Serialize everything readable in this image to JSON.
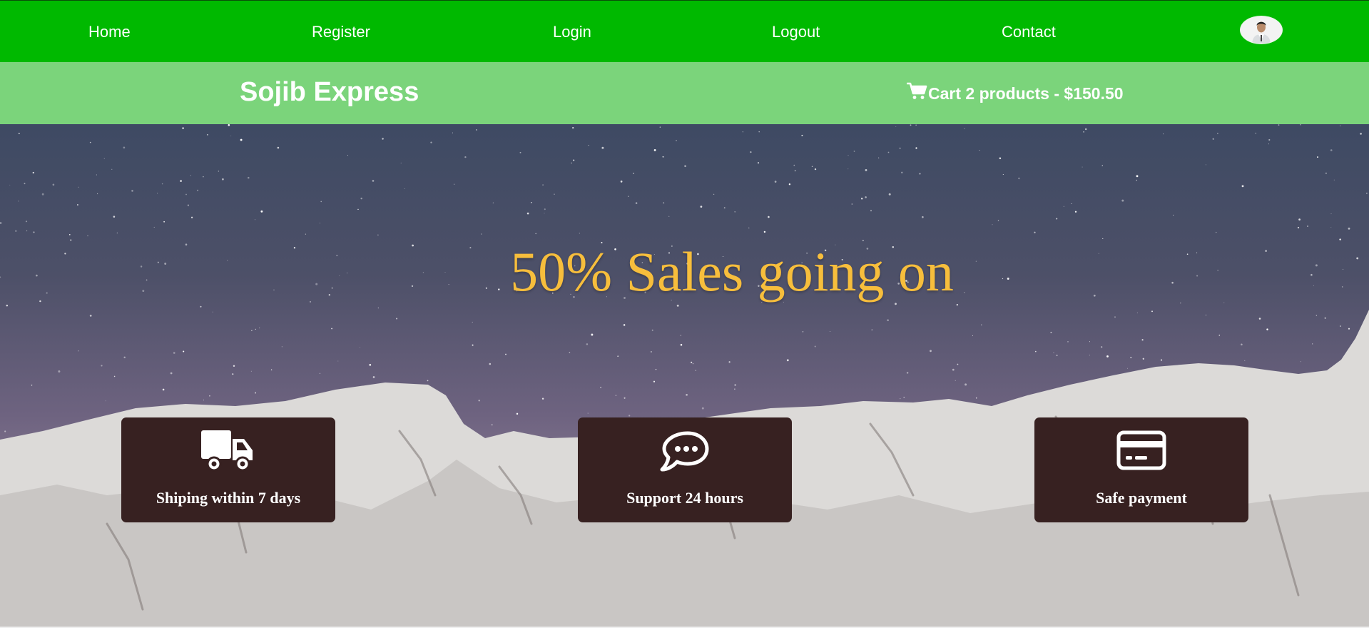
{
  "nav": {
    "items": [
      {
        "label": "Home"
      },
      {
        "label": "Register"
      },
      {
        "label": "Login"
      },
      {
        "label": "Logout"
      },
      {
        "label": "Contact"
      }
    ],
    "avatar_icon": "user-avatar"
  },
  "header": {
    "brand": "Sojib Express",
    "cart_label": "Cart 2 products - $150.50",
    "cart_icon": "cart-icon"
  },
  "hero": {
    "headline": "50% Sales going on"
  },
  "features": [
    {
      "label": "Shiping within 7 days",
      "icon": "truck-icon"
    },
    {
      "label": "Support 24 hours",
      "icon": "chat-icon"
    },
    {
      "label": "Safe payment",
      "icon": "credit-card-icon"
    }
  ],
  "colors": {
    "nav_bg": "#00b900",
    "subbar_bg": "#7bd47b",
    "headline": "#f7be3c",
    "feature_bg": "#372121"
  }
}
